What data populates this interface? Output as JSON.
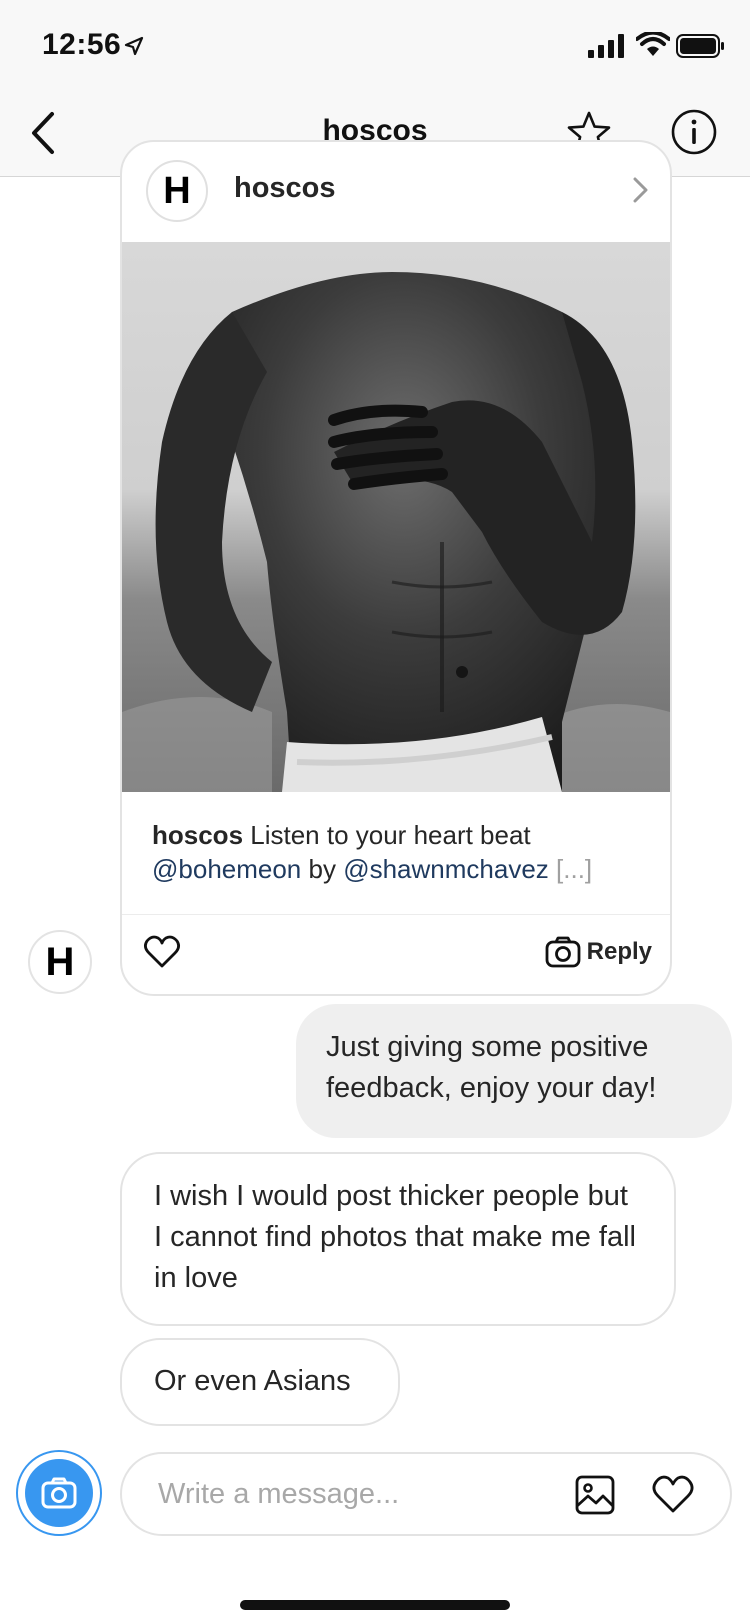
{
  "status_bar": {
    "time": "12:56",
    "icons": [
      "location-arrow-icon",
      "cellular-signal-icon",
      "wifi-icon",
      "battery-icon"
    ]
  },
  "header": {
    "title": "hoscos",
    "icons": [
      "back-chevron-icon",
      "star-icon",
      "info-icon"
    ]
  },
  "shared_post": {
    "avatar_letter": "H",
    "username": "hoscos",
    "caption_user": "hoscos",
    "caption_text": " Listen to your heart beat",
    "caption_mention1": "@bohemeon",
    "caption_by": " by ",
    "caption_mention2": "@shawnmchavez",
    "caption_more": " [...]",
    "reply_label": "Reply",
    "icons": [
      "chevron-right-icon",
      "heart-icon",
      "camera-icon"
    ]
  },
  "sender_avatar_letter": "H",
  "messages": [
    {
      "direction": "outgoing",
      "text": "Just giving some positive feedback, enjoy your day!"
    },
    {
      "direction": "incoming",
      "text": "I wish I would post thicker people but I cannot find photos that make me fall in love"
    },
    {
      "direction": "incoming",
      "text": "Or even Asians"
    }
  ],
  "composer": {
    "placeholder": "Write a message...",
    "value": "",
    "icons": [
      "camera-icon",
      "gallery-icon",
      "heart-icon"
    ]
  },
  "colors": {
    "accent_blue": "#3897f0",
    "link_blue": "#1f3a5f",
    "outgoing_bubble": "#efefef",
    "border": "#e3e3e3"
  }
}
